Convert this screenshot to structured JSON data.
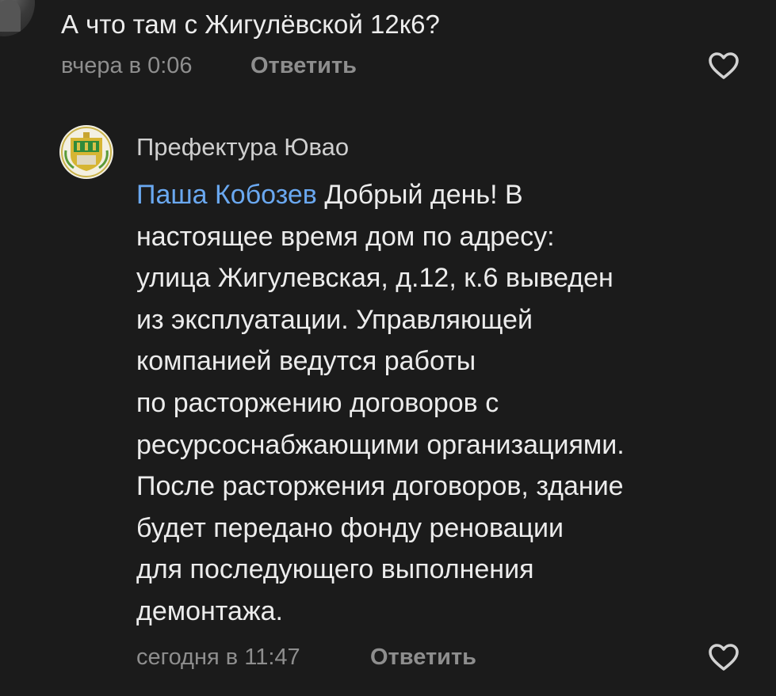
{
  "comments": [
    {
      "text": "А что там с Жигулёвской 12к6?",
      "time": "вчера в 0:06",
      "reply_label": "Ответить",
      "like_icon": "heart-outline-icon"
    },
    {
      "author": "Префектура Ювао",
      "mention": "Паша Кобозев",
      "lines": [
        "Добрый день! В",
        "настоящее время дом по адресу:",
        "улица Жигулевская, д.12, к.6 выведен",
        "из эксплуатации. Управляющей",
        "компанией ведутся работы",
        "по расторжению договоров с",
        "ресурсоснабжающими организациями.",
        "После расторжения договоров, здание",
        "будет передано фонду реновации",
        "для последующего выполнения",
        "демонтажа."
      ],
      "time": "сегодня в 11:47",
      "reply_label": "Ответить",
      "like_icon": "heart-outline-icon"
    }
  ],
  "colors": {
    "background": "#1b1b1b",
    "text": "#ececec",
    "meta": "#8e8e8e",
    "mention": "#6aa8f0"
  }
}
